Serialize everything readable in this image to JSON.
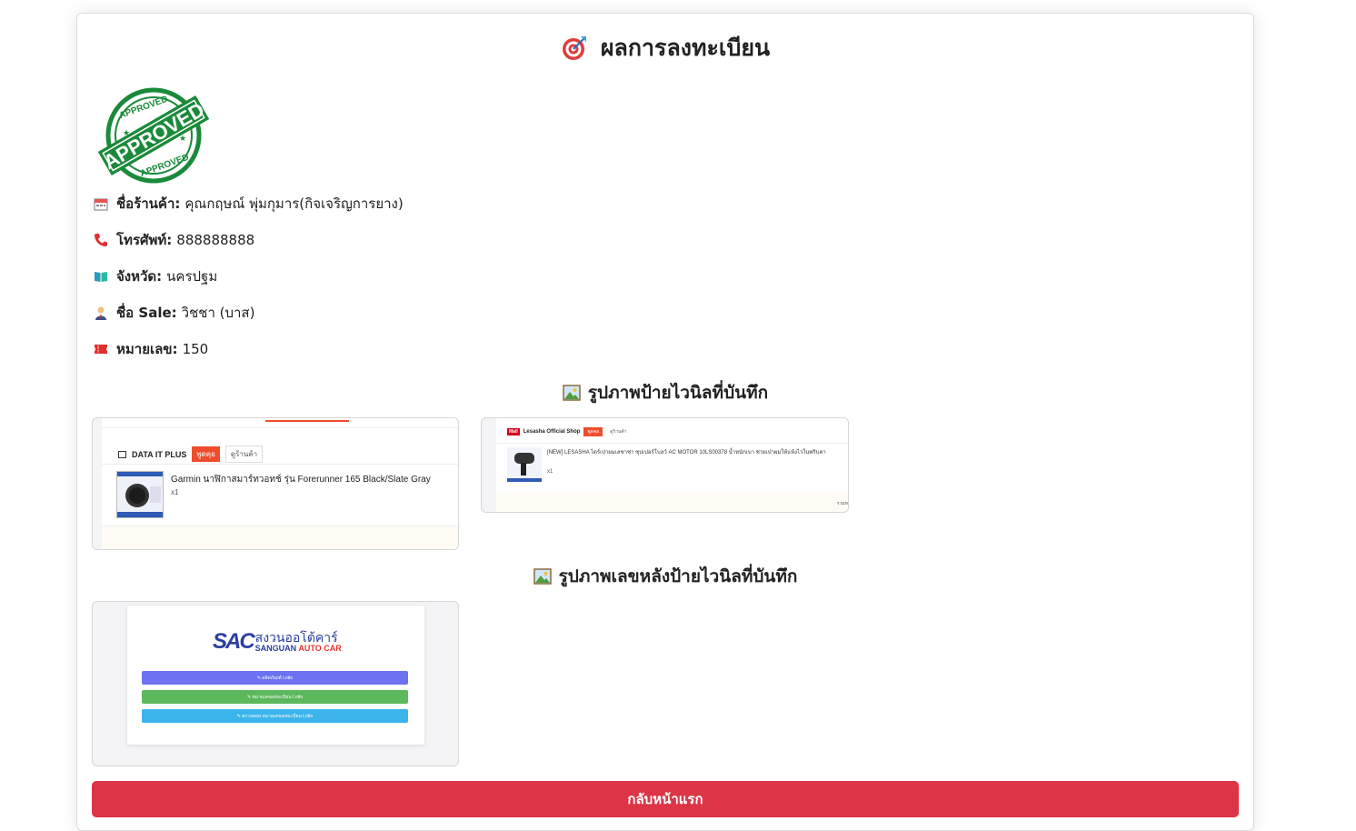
{
  "page": {
    "title": "ผลการลงทะเบียน",
    "title_icon": "target-icon"
  },
  "stamp": {
    "text": "APPROVED",
    "color": "#1a8a3a"
  },
  "info": [
    {
      "icon": "store-calendar-icon",
      "label": "ชื่อร้านค้า:",
      "value": "คุณกฤษณ์ พุ่มกุมาร(กิจเจริญการยาง)"
    },
    {
      "icon": "phone-icon",
      "label": "โทรศัพท์:",
      "value": "888888888"
    },
    {
      "icon": "map-book-icon",
      "label": "จังหวัด:",
      "value": "นครปฐม"
    },
    {
      "icon": "salesperson-icon",
      "label": "ชื่อ Sale:",
      "value": "วิชชา (บาส)"
    },
    {
      "icon": "ticket-icon",
      "label": "หมายเลข:",
      "value": "150"
    }
  ],
  "sections": {
    "front": {
      "title": "รูปภาพป้ายไวนิลที่บันทึก",
      "icon": "picture-icon"
    },
    "back": {
      "title": "รูปภาพเลขหลังป้ายไวนิลที่บันทึก",
      "icon": "picture-icon"
    }
  },
  "thumbs": {
    "t1": {
      "shop": "DATA IT PLUS",
      "chat": "พูดคุย",
      "view": "ดูร้านค้า",
      "product": "Garmin นาฬิกาสมาร์ทวอทช์ รุ่น Forerunner 165 Black/Slate Gray",
      "qty": "x1"
    },
    "t2": {
      "badge": "Mall",
      "shop": "Lesasha Official Shop",
      "chat": "พูดคุย",
      "view": "ดูร้านค้า",
      "product": "[NEW] LESASHA ไดร์เป่าผมเลซาช่า ซุปเปอร์โบลว์ AC MOTOR 10LS00378 น้ำหนักเบา ช่วยเป่าผมให้แห้งไวในพริบตา",
      "qty": "x1",
      "total": "รวมท"
    },
    "t3": {
      "logo": "SAC",
      "brand_th": "สงวนออโต้คาร์",
      "brand_en_1": "SANGUAN",
      "brand_en_2": "AUTO CAR",
      "btn1": "✎ ผลิตภัณฑ์ Lotto",
      "btn2": "✎ หมายเลขลงทะเบียน Lotto",
      "btn3": "✎ ตรวจสอบ หมายเลขลงทะเบียน Lotto",
      "btn1_color": "#6c72f0",
      "btn2_color": "#5cb85c",
      "btn3_color": "#3bb4ec"
    }
  },
  "button": {
    "home": "กลับหน้าแรก",
    "color": "#dc3545"
  }
}
